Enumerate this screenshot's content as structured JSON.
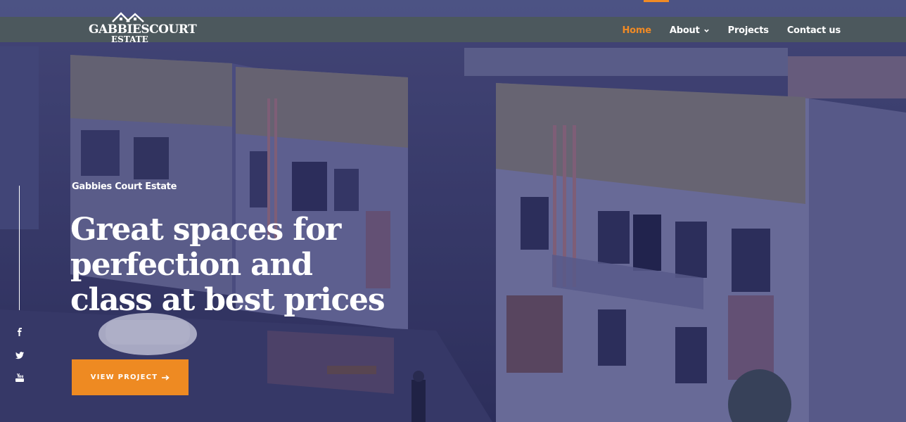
{
  "brand": {
    "line1": "GABBIESCOURT",
    "line2": "ESTATE"
  },
  "nav": {
    "items": [
      {
        "label": "Home",
        "active": true
      },
      {
        "label": "About",
        "dropdown": true
      },
      {
        "label": "Projects"
      },
      {
        "label": "Contact us"
      }
    ]
  },
  "hero": {
    "eyebrow": "Gabbies Court Estate",
    "headline": [
      "Great spaces for",
      "perfection and",
      "class at best prices"
    ],
    "cta_label": "VIEW PROJECT"
  },
  "social": [
    "facebook-icon",
    "twitter-icon",
    "youtube-icon"
  ],
  "colors": {
    "accent": "#ee8a22",
    "text": "#ffffff"
  }
}
